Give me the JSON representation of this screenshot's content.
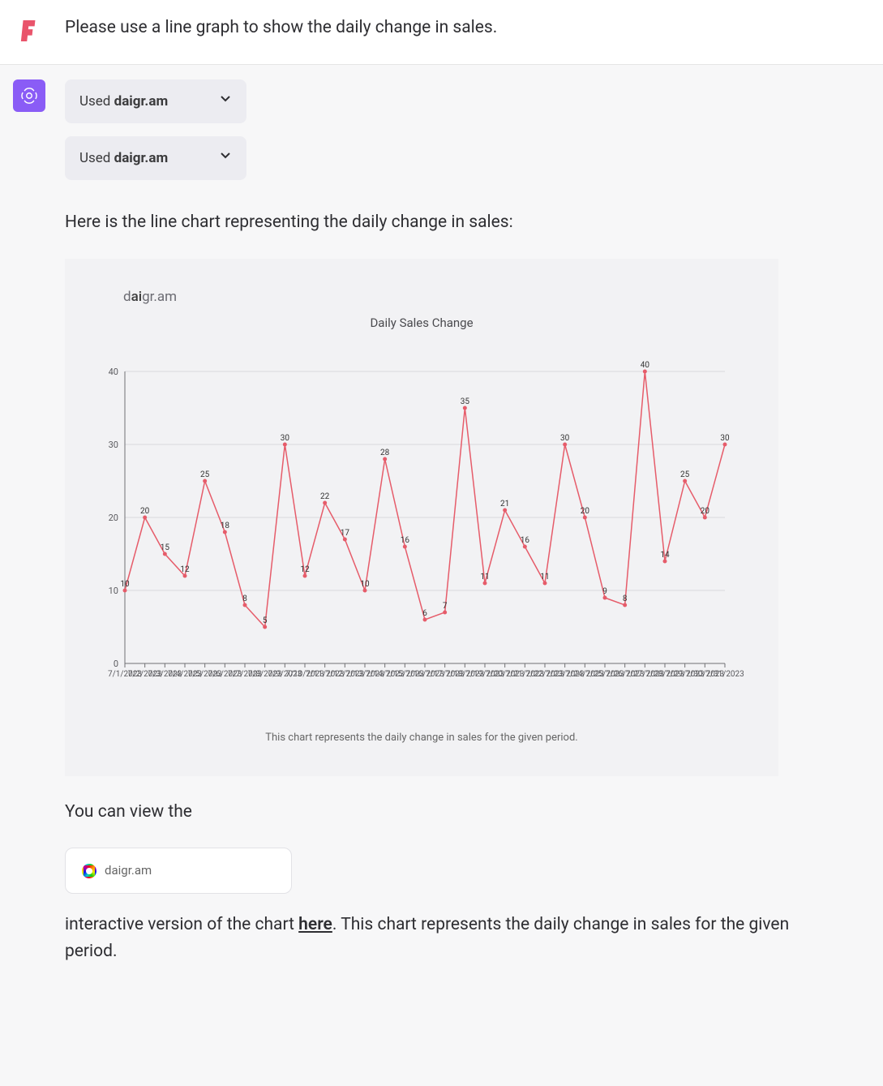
{
  "user": {
    "message": "Please use a line graph to show the daily change in sales."
  },
  "assistant": {
    "tool_chips": [
      {
        "prefix": "Used ",
        "name": "daigr.am"
      },
      {
        "prefix": "Used ",
        "name": "daigr.am"
      }
    ],
    "intro": "Here is the line chart representing the daily change in sales:",
    "after_chart_1": "You can view the",
    "link_card": {
      "label": "daigr.am"
    },
    "after_chart_2a": "interactive version of the chart ",
    "link_text": "here",
    "after_chart_2b": ". This chart represents the daily change in sales for the given period."
  },
  "chart_brand": {
    "pre": "d",
    "ai": "ai",
    "post": "gr.am"
  },
  "chart_data": {
    "type": "line",
    "title": "Daily Sales Change",
    "caption": "This chart represents the daily change in sales for the given period.",
    "xlabel": "",
    "ylabel": "",
    "ylim": [
      0,
      40
    ],
    "y_ticks": [
      0,
      10,
      20,
      30,
      40
    ],
    "x": [
      "7/1/2023",
      "7/2/2023",
      "7/3/2023",
      "7/4/2023",
      "7/5/2023",
      "7/6/2023",
      "7/7/2023",
      "7/8/2023",
      "7/9/2023",
      "7/10/2023",
      "7/11/2023",
      "7/12/2023",
      "7/13/2023",
      "7/14/2023",
      "7/15/2023",
      "7/16/2023",
      "7/17/2023",
      "7/18/2023",
      "7/19/2023",
      "7/20/2023",
      "7/21/2023",
      "7/22/2023",
      "7/23/2023",
      "7/24/2023",
      "7/25/2023",
      "7/26/2023",
      "7/27/2023",
      "7/28/2023",
      "7/29/2023",
      "7/30/2023",
      "7/31/2023"
    ],
    "values": [
      10,
      20,
      15,
      12,
      25,
      18,
      8,
      5,
      30,
      12,
      22,
      17,
      10,
      28,
      16,
      6,
      7,
      35,
      11,
      21,
      16,
      11,
      30,
      20,
      9,
      8,
      40,
      14,
      25,
      20,
      30
    ]
  }
}
